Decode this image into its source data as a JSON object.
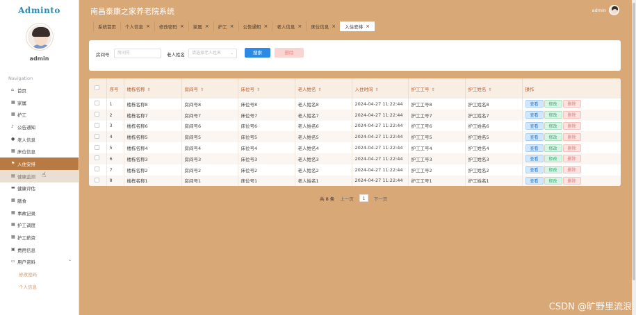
{
  "brand": "Adminto",
  "sidebar": {
    "username": "admin",
    "nav_heading": "Navigation",
    "items": [
      {
        "label": "首页",
        "icon": "home-icon"
      },
      {
        "label": "家属",
        "icon": "grid-icon"
      },
      {
        "label": "护工",
        "icon": "grid-icon"
      },
      {
        "label": "公告通知",
        "icon": "bell-icon"
      },
      {
        "label": "老人信息",
        "icon": "user-icon"
      },
      {
        "label": "床位信息",
        "icon": "grid-icon"
      },
      {
        "label": "入住安排",
        "icon": "flag-icon"
      },
      {
        "label": "健康监测",
        "icon": "heart-icon"
      },
      {
        "label": "健康评估",
        "icon": "clipboard-icon"
      },
      {
        "label": "膳食",
        "icon": "grid-icon"
      },
      {
        "label": "事故记录",
        "icon": "grid-icon"
      },
      {
        "label": "护工调度",
        "icon": "grid-icon"
      },
      {
        "label": "护工薪资",
        "icon": "grid-icon"
      },
      {
        "label": "费用信息",
        "icon": "wallet-icon"
      },
      {
        "label": "用户资料",
        "icon": "folder-icon"
      }
    ],
    "sub_items": [
      "修改密码",
      "个人信息"
    ]
  },
  "header": {
    "title": "南昌泰康之家养老院系统",
    "user": "admin"
  },
  "tabs": [
    {
      "label": "系统首页",
      "closable": false
    },
    {
      "label": "个人信息",
      "closable": true
    },
    {
      "label": "修改密码",
      "closable": true
    },
    {
      "label": "家属",
      "closable": true
    },
    {
      "label": "护工",
      "closable": true
    },
    {
      "label": "公告通知",
      "closable": true
    },
    {
      "label": "老人信息",
      "closable": true
    },
    {
      "label": "床位信息",
      "closable": true
    },
    {
      "label": "入住安排",
      "closable": true
    }
  ],
  "search": {
    "room_label": "房间号",
    "room_placeholder": "房间号",
    "elder_label": "老人姓名",
    "elder_placeholder": "请选择老人姓名",
    "search_button": "搜索",
    "delete_button": "删除"
  },
  "table": {
    "headers": [
      "序号",
      "楼栋名称",
      "房间号",
      "床位号",
      "老人姓名",
      "入住时间",
      "护工工号",
      "护工姓名",
      "操作"
    ],
    "sortable": [
      false,
      true,
      true,
      true,
      true,
      true,
      true,
      true,
      false
    ],
    "actions": {
      "view": "查看",
      "edit": "修改",
      "delete": "删除"
    },
    "rows": [
      [
        "1",
        "楼栋名称8",
        "房间号8",
        "床位号8",
        "老人姓名8",
        "2024-04-27 11:22:44",
        "护工工号8",
        "护工姓名8"
      ],
      [
        "2",
        "楼栋名称7",
        "房间号7",
        "床位号7",
        "老人姓名7",
        "2024-04-27 11:22:44",
        "护工工号7",
        "护工姓名7"
      ],
      [
        "3",
        "楼栋名称6",
        "房间号6",
        "床位号6",
        "老人姓名6",
        "2024-04-27 11:22:44",
        "护工工号6",
        "护工姓名6"
      ],
      [
        "4",
        "楼栋名称5",
        "房间号5",
        "床位号5",
        "老人姓名5",
        "2024-04-27 11:22:44",
        "护工工号5",
        "护工姓名5"
      ],
      [
        "5",
        "楼栋名称4",
        "房间号4",
        "床位号4",
        "老人姓名4",
        "2024-04-27 11:22:44",
        "护工工号4",
        "护工姓名4"
      ],
      [
        "6",
        "楼栋名称3",
        "房间号3",
        "床位号3",
        "老人姓名3",
        "2024-04-27 11:22:44",
        "护工工号3",
        "护工姓名3"
      ],
      [
        "7",
        "楼栋名称2",
        "房间号2",
        "床位号2",
        "老人姓名2",
        "2024-04-27 11:22:44",
        "护工工号2",
        "护工姓名2"
      ],
      [
        "8",
        "楼栋名称1",
        "房间号1",
        "床位号1",
        "老人姓名1",
        "2024-04-27 11:22:44",
        "护工工号1",
        "护工姓名1"
      ]
    ]
  },
  "pagination": {
    "total": "共 8 条",
    "prev": "上一页",
    "current": "1",
    "next": "下一页"
  },
  "watermark": "CSDN @旷野里流浪",
  "colors": {
    "background": "#d9a877",
    "active_nav": "#b87a43",
    "primary": "#2a8ae6",
    "header_text": "#b55a2c"
  }
}
